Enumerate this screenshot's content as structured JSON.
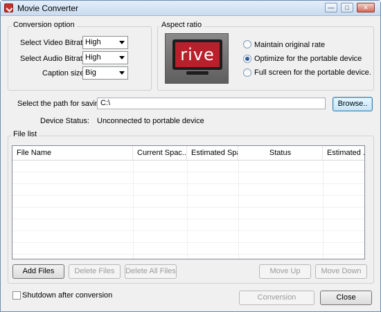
{
  "window": {
    "title": "Movie Converter"
  },
  "conversion": {
    "title": "Conversion option",
    "video_bitrate_label": "Select Video Bitrate:",
    "video_bitrate_value": "High",
    "audio_bitrate_label": "Select Audio Bitrate:",
    "audio_bitrate_value": "High",
    "caption_label": "Caption size:",
    "caption_value": "Big"
  },
  "aspect": {
    "title": "Aspect ratio",
    "logo_text": "rive",
    "options": [
      {
        "label": "Maintain original rate",
        "checked": false
      },
      {
        "label": "Optimize for the portable device",
        "checked": true
      },
      {
        "label": "Full screen for the portable device.",
        "checked": false
      }
    ]
  },
  "save": {
    "label": "Select the path for saving:",
    "path": "C:\\",
    "browse_label": "Browse.."
  },
  "device": {
    "label": "Device Status:",
    "value": "Unconnected to portable device"
  },
  "file_list": {
    "title": "File list",
    "columns": [
      "File Name",
      "Current Spac...",
      "Estimated Spa...",
      "Status",
      "Estimated ..."
    ],
    "rows": []
  },
  "buttons": {
    "add_files": "Add Files",
    "delete_files": "Delete Files",
    "delete_all_files": "Delete All Files",
    "move_up": "Move Up",
    "move_down": "Move Down",
    "conversion": "Conversion",
    "close": "Close"
  },
  "shutdown": {
    "label": "Shutdown after conversion",
    "checked": false
  },
  "colors": {
    "logo_red": "#b8212b",
    "title_gradient_top": "#e4eef9",
    "title_gradient_bottom": "#c9dbef"
  }
}
